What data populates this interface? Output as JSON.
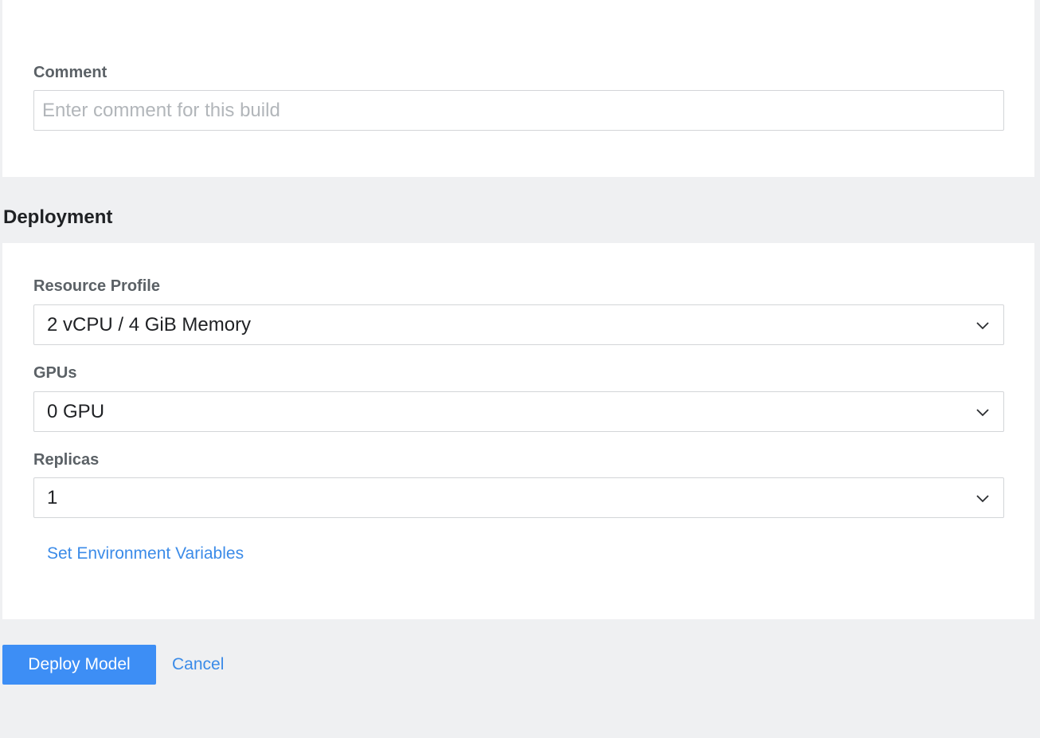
{
  "build": {
    "comment_label": "Comment",
    "comment_placeholder": "Enter comment for this build",
    "comment_value": ""
  },
  "deployment": {
    "title": "Deployment",
    "resource_profile": {
      "label": "Resource Profile",
      "value": "2 vCPU / 4 GiB Memory"
    },
    "gpus": {
      "label": "GPUs",
      "value": "0 GPU"
    },
    "replicas": {
      "label": "Replicas",
      "value": "1"
    },
    "env_link": "Set Environment Variables"
  },
  "actions": {
    "deploy_label": "Deploy Model",
    "cancel_label": "Cancel"
  },
  "colors": {
    "accent": "#3d8ef5",
    "link": "#3b8be8",
    "background": "#eff0f2"
  },
  "icons": {
    "select_caret": "chevron-down-icon"
  }
}
